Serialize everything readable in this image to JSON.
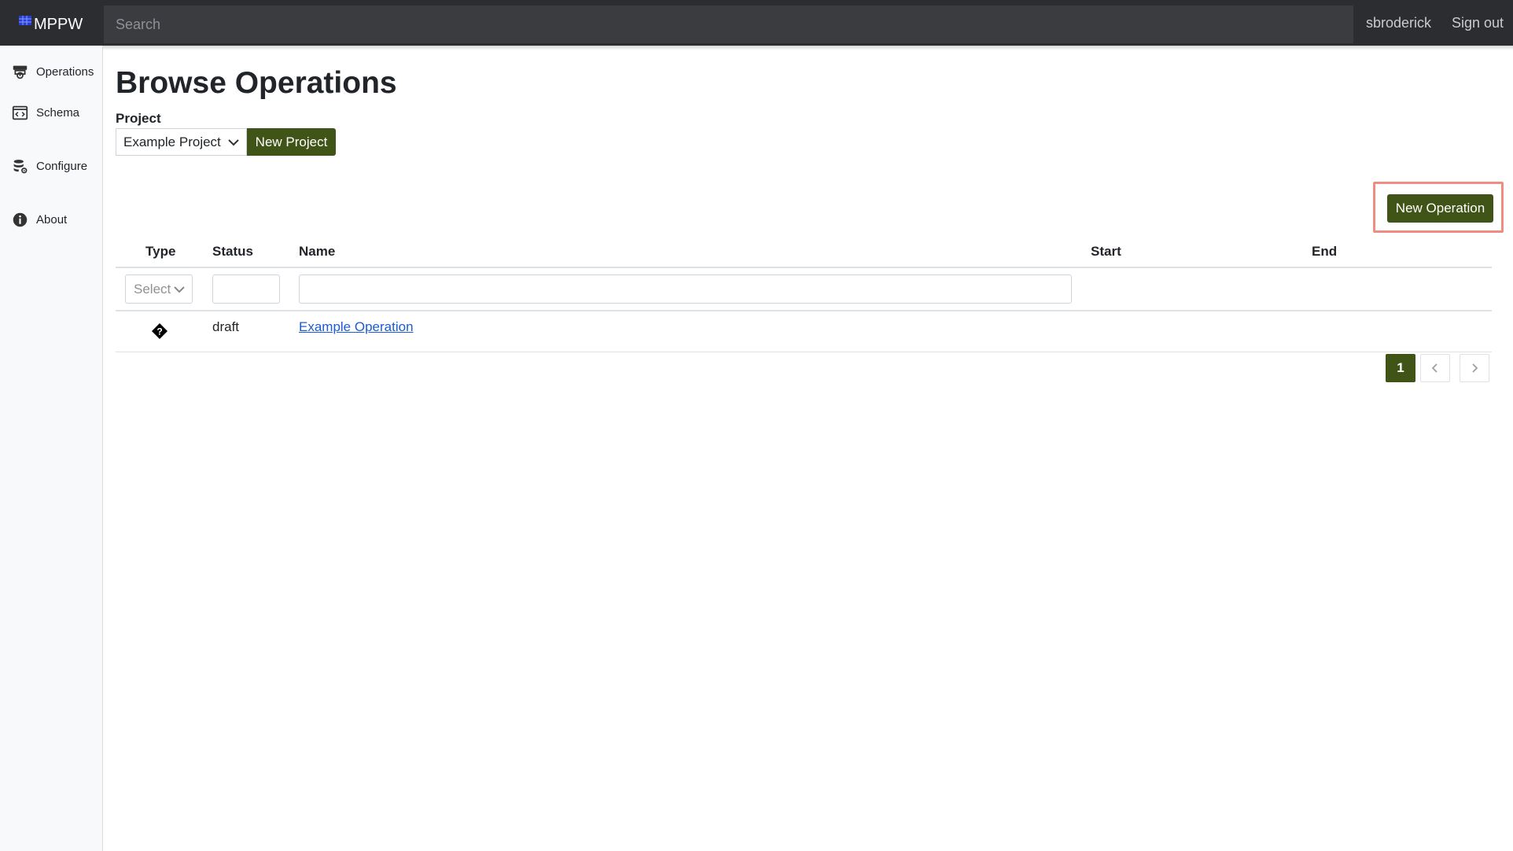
{
  "app": {
    "name": "MPPW"
  },
  "header": {
    "search_placeholder": "Search",
    "username": "sbroderick",
    "signout_label": "Sign out"
  },
  "sidebar": {
    "items": [
      {
        "label": "Operations",
        "icon": "operations-icon"
      },
      {
        "label": "Schema",
        "icon": "schema-icon"
      },
      {
        "label": "Configure",
        "icon": "configure-icon"
      },
      {
        "label": "About",
        "icon": "info-icon"
      }
    ]
  },
  "main": {
    "title": "Browse Operations",
    "project_label": "Project",
    "project_selected": "Example Project",
    "new_project_label": "New Project",
    "new_operation_label": "New Operation",
    "table": {
      "columns": [
        "Type",
        "Status",
        "Name",
        "Start",
        "End"
      ],
      "type_filter_placeholder": "Select",
      "rows": [
        {
          "type_icon": "unknown-type-icon",
          "status": "draft",
          "name": "Example Operation",
          "start": "",
          "end": ""
        }
      ]
    },
    "pagination": {
      "current_page": "1"
    }
  },
  "colors": {
    "accent": "#3f5416",
    "topbar": "#2b2d30",
    "highlight": "#ee8e82",
    "link": "#1a5bd8"
  }
}
